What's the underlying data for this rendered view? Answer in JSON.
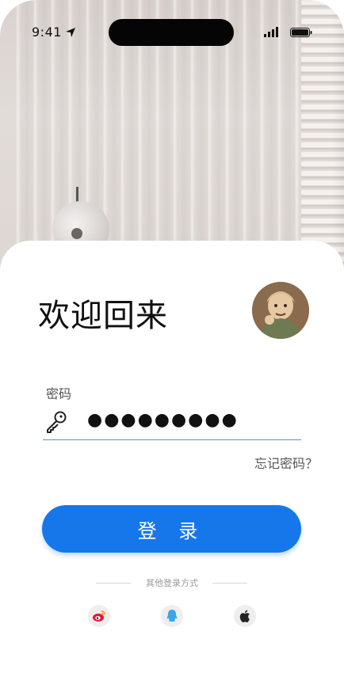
{
  "status_bar": {
    "time": "9:41"
  },
  "login": {
    "welcome_title": "欢迎回来",
    "password_label": "密码",
    "password_masked": "●●●●●●●●●",
    "forgot_password": "忘记密码？",
    "login_button": "登 录",
    "other_methods": "其他登录方式"
  },
  "social": [
    {
      "name": "weibo",
      "icon": "weibo-icon"
    },
    {
      "name": "qq",
      "icon": "qq-icon"
    },
    {
      "name": "apple",
      "icon": "apple-icon"
    }
  ],
  "colors": {
    "accent": "#1677ea",
    "underline": "#5a8fc5"
  }
}
